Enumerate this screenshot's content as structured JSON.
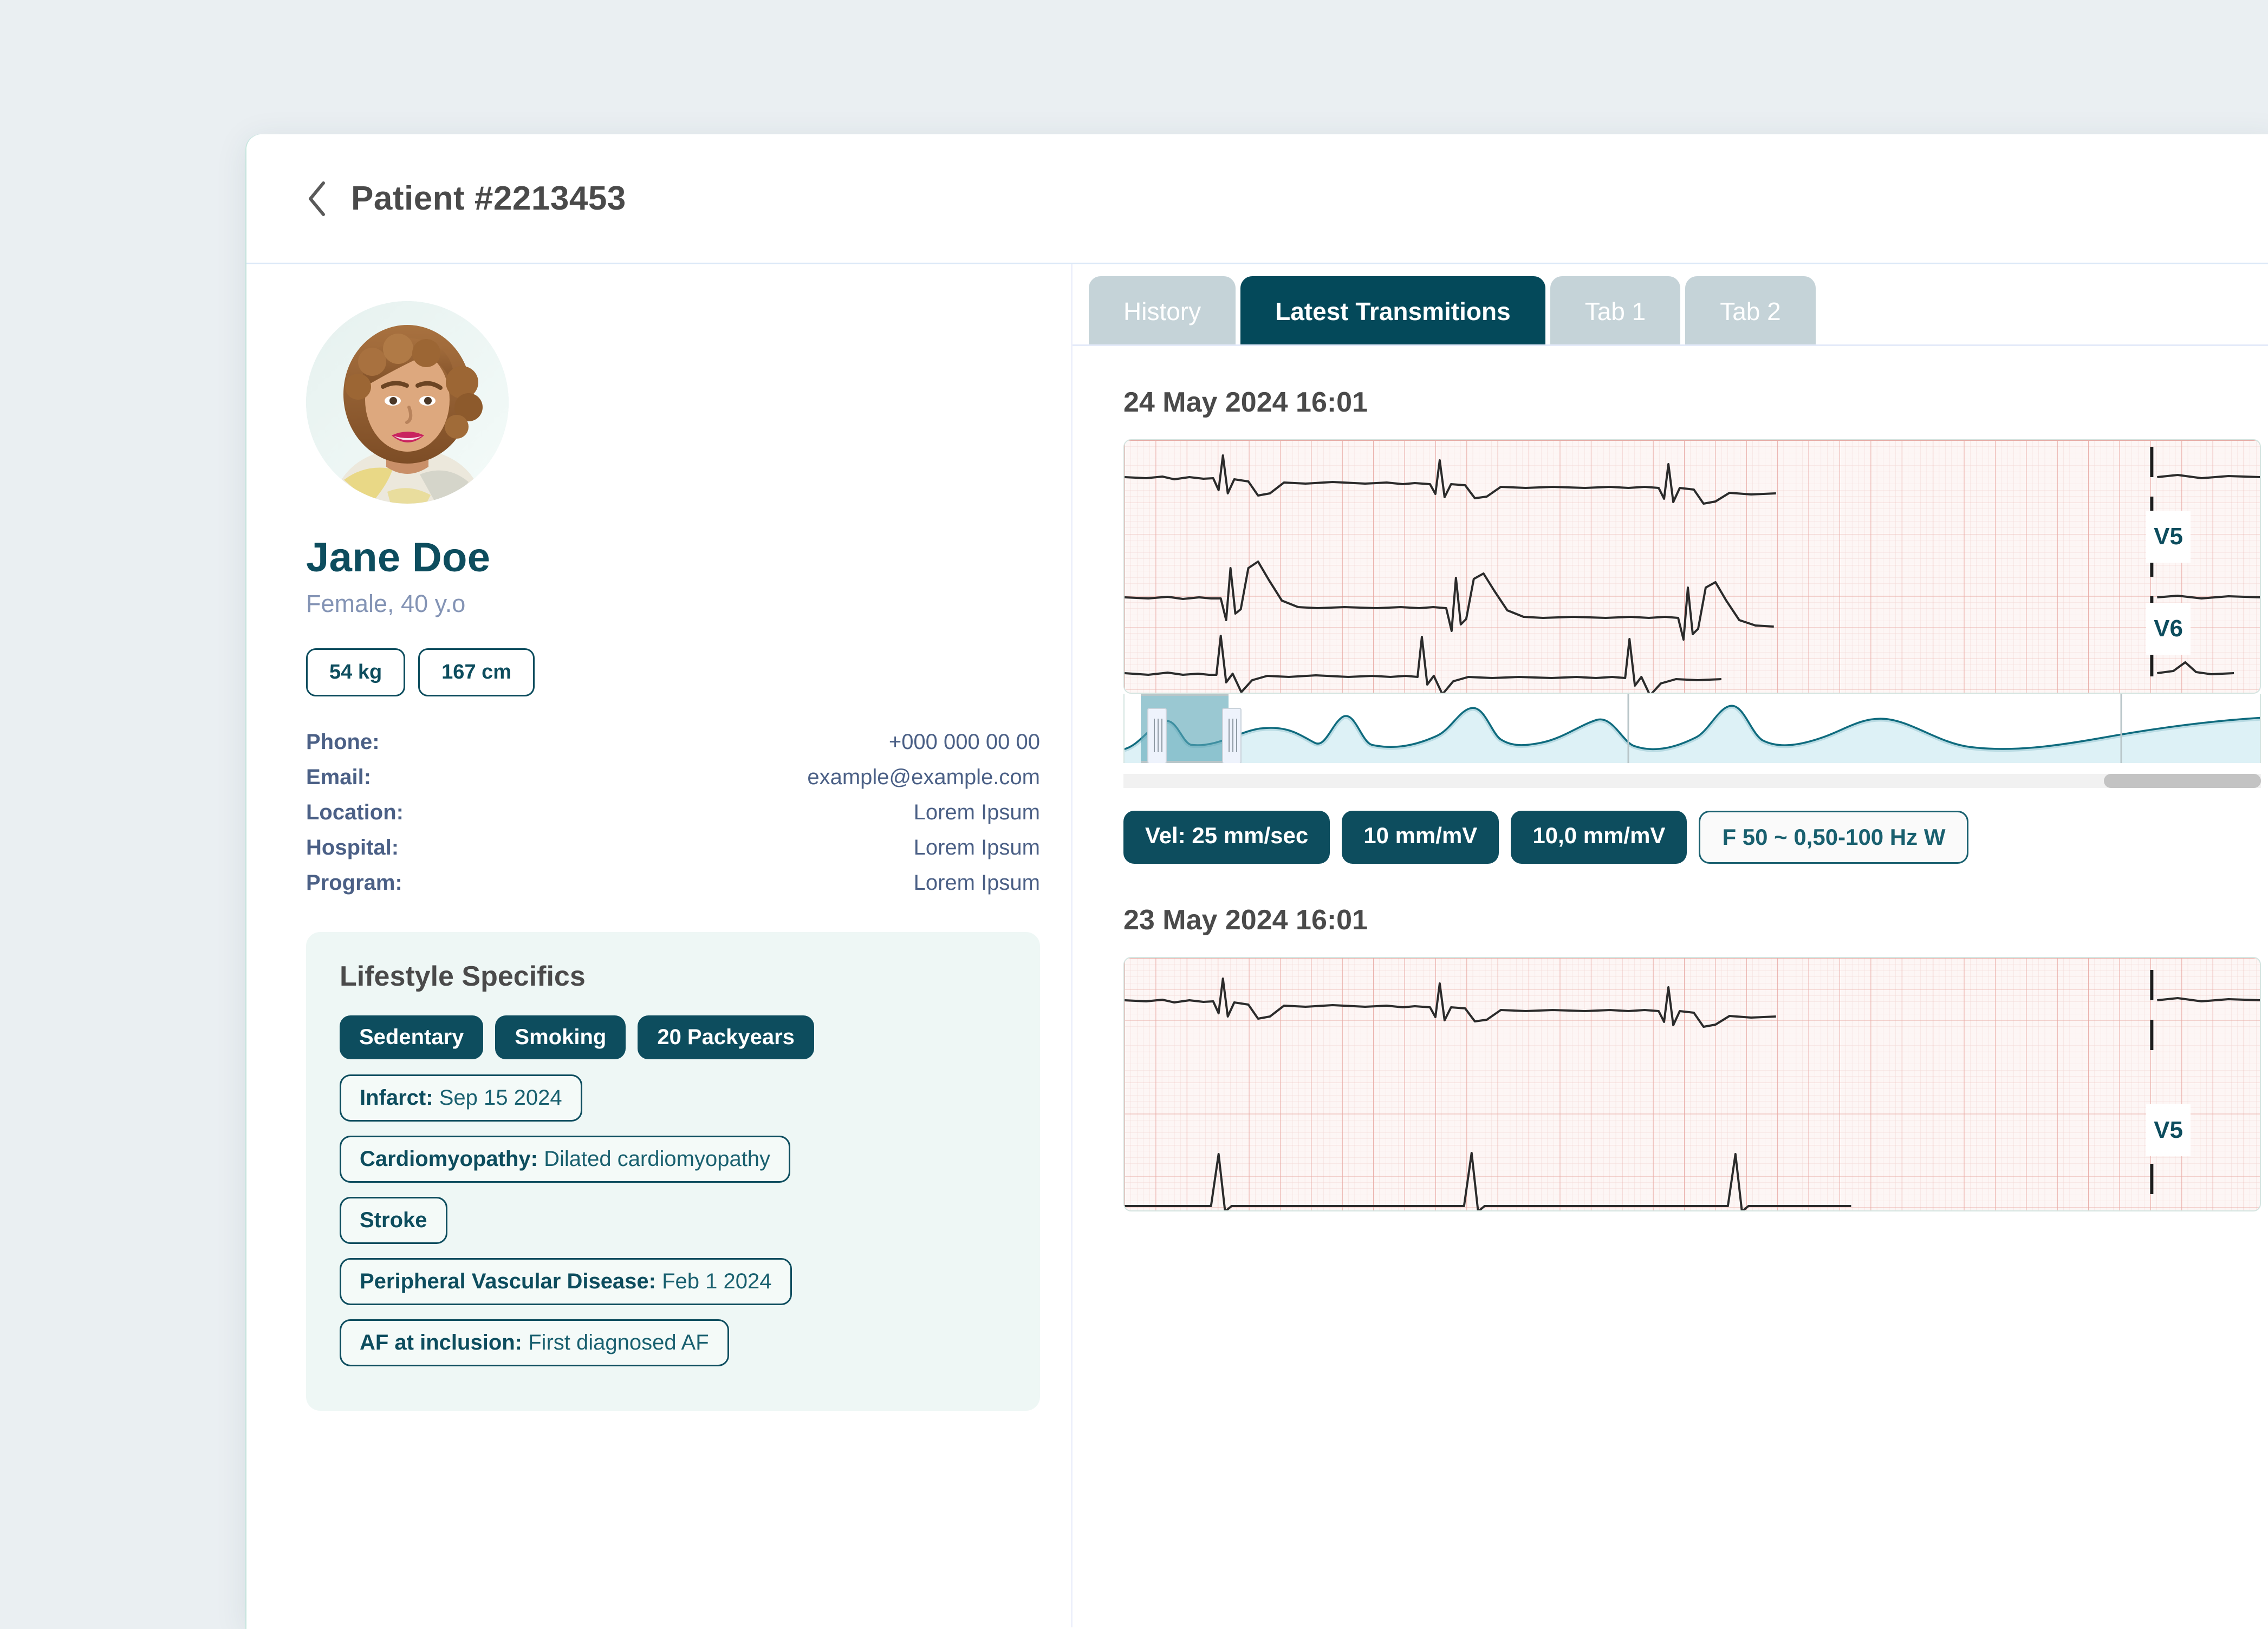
{
  "header": {
    "back_icon": "chevron-left-icon",
    "title": "Patient #2213453"
  },
  "patient": {
    "avatar_alt": "patient-photo",
    "name": "Jane Doe",
    "demographics": "Female, 40 y.o",
    "metrics": [
      {
        "label": "54 kg"
      },
      {
        "label": "167 cm"
      }
    ],
    "contact": [
      {
        "label": "Phone:",
        "value": "+000 000 00 00"
      },
      {
        "label": "Email:",
        "value": "example@example.com"
      },
      {
        "label": "Location:",
        "value": "Lorem Ipsum"
      },
      {
        "label": "Hospital:",
        "value": "Lorem Ipsum"
      },
      {
        "label": "Program:",
        "value": "Lorem Ipsum"
      }
    ]
  },
  "lifestyle": {
    "title": "Lifestyle Specifics",
    "solid_tags": [
      {
        "label": "Sedentary"
      },
      {
        "label": "Smoking"
      },
      {
        "label": "20 Packyears"
      }
    ],
    "outline_tags": [
      {
        "key": "Infarct:",
        "value": "Sep 15 2024"
      },
      {
        "key": "Cardiomyopathy:",
        "value": "Dilated cardiomyopathy"
      },
      {
        "key": "Stroke",
        "value": ""
      },
      {
        "key": "Peripheral Vascular Disease:",
        "value": "Feb 1 2024"
      },
      {
        "key": "AF at inclusion:",
        "value": "First diagnosed AF"
      }
    ]
  },
  "tabs": [
    {
      "label": "History",
      "active": false
    },
    {
      "label": "Latest Transmitions",
      "active": true
    },
    {
      "label": "Tab 1",
      "active": false
    },
    {
      "label": "Tab 2",
      "active": false
    }
  ],
  "transmissions": [
    {
      "date": "24 May 2024 16:01",
      "leads": [
        "V5",
        "V6"
      ]
    },
    {
      "date": "23 May 2024 16:01",
      "leads": [
        "V5"
      ]
    }
  ],
  "ecg_controls": [
    {
      "label": "Vel:  25 mm/sec",
      "style": "solid"
    },
    {
      "label": "10 mm/mV",
      "style": "solid"
    },
    {
      "label": "10,0 mm/mV",
      "style": "solid"
    },
    {
      "label": "F 50 ~ 0,50-100 Hz W",
      "style": "outline"
    }
  ],
  "colors": {
    "brand_dark": "#0d4d5e",
    "tab_inactive": "#c5d3d8",
    "page_bg": "#eaeff2",
    "card_mint": "#eef7f5",
    "label_blue": "#4b6086",
    "muted_blue": "#8494b5",
    "ecg_paper": "#fdf6f5",
    "minimap_teal": "#0f6b7e"
  },
  "chart_data": [
    {
      "type": "line",
      "title": "24 May 2024 16:01",
      "leads": [
        "V5",
        "V6"
      ],
      "paper_speed_mm_per_sec": 25,
      "gain_mm_per_mV": 10,
      "filter": "F 50 ~ 0,50-100 Hz W",
      "grid": true,
      "beats_visible": 3,
      "series": [
        {
          "name": "lead-1",
          "description": "sinus rhythm strip, 3 QRS complexes"
        },
        {
          "name": "V5",
          "description": "sinus rhythm strip, tall R waves, 3 QRS complexes"
        },
        {
          "name": "V6",
          "description": "sinus rhythm strip, sharp R waves, 3 QRS complexes"
        }
      ],
      "minimap": {
        "selection_start_pct": 1,
        "selection_end_pct": 9
      }
    },
    {
      "type": "line",
      "title": "23 May 2024 16:01",
      "leads": [
        "V5"
      ],
      "grid": true,
      "beats_visible": 3,
      "series": [
        {
          "name": "lead-1",
          "description": "sinus rhythm strip, 3 QRS complexes"
        },
        {
          "name": "V5",
          "description": "sinus rhythm strip, partially visible"
        }
      ]
    }
  ]
}
